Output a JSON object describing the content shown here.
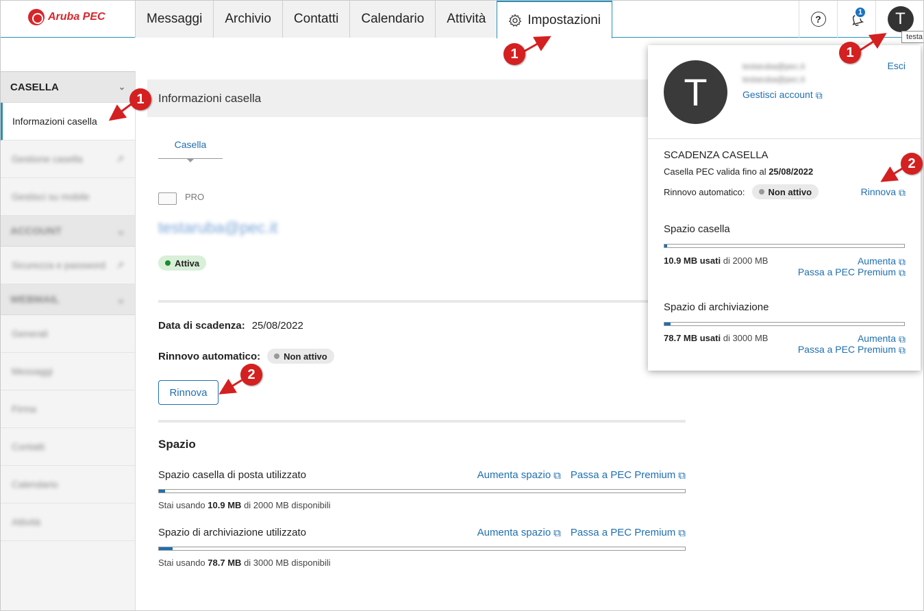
{
  "app": {
    "logo_text": "Aruba PEC"
  },
  "nav": {
    "tabs": [
      {
        "label": "Messaggi"
      },
      {
        "label": "Archivio"
      },
      {
        "label": "Contatti"
      },
      {
        "label": "Calendario"
      },
      {
        "label": "Attività"
      },
      {
        "label": "Impostazioni",
        "icon": "gear-icon",
        "active": true
      }
    ],
    "help_icon": "?",
    "notifications_count": "1",
    "avatar_letter": "T",
    "tooltip": "testa"
  },
  "sidebar": {
    "section1": "CASELLA",
    "items": [
      {
        "label": "Informazioni casella",
        "active": true
      },
      {
        "label": "Gestione casella"
      },
      {
        "label": "Gestisci su mobile"
      }
    ],
    "section2": "ACCOUNT",
    "items2": [
      {
        "label": "Sicurezza e password"
      }
    ],
    "section3": "WEBMAIL",
    "items3": [
      {
        "label": "Generali"
      },
      {
        "label": "Messaggi"
      },
      {
        "label": "Firma"
      },
      {
        "label": "Contatti"
      },
      {
        "label": "Calendario"
      },
      {
        "label": "Attività"
      }
    ]
  },
  "main": {
    "section_title": "Informazioni casella",
    "subtab": "Casella",
    "plan": "PRO",
    "address": "testaruba@pec.it",
    "status": "Attiva",
    "expiry_label": "Data di scadenza:",
    "expiry_value": "25/08/2022",
    "renew_label": "Rinnovo automatico:",
    "renew_status": "Non attivo",
    "renew_button": "Rinnova",
    "space_title": "Spazio",
    "mailbox": {
      "label": "Spazio casella di posta utilizzato",
      "link1": "Aumenta spazio",
      "link2": "Passa a PEC Premium",
      "prefix": "Stai usando",
      "used": "10.9 MB",
      "suffix": "di 2000 MB disponibili",
      "fill_fraction": 0.0055
    },
    "archive": {
      "label": "Spazio di archiviazione utilizzato",
      "link1": "Aumenta spazio",
      "link2": "Passa a PEC Premium",
      "prefix": "Stai usando",
      "used": "78.7 MB",
      "suffix": "di 3000 MB disponibili",
      "fill_fraction": 0.026
    }
  },
  "popup": {
    "avatar_letter": "T",
    "name_line1": "testaruba@pec.it",
    "name_line2": "testaruba@pec.it",
    "manage_account": "Gestisci account",
    "exit": "Esci",
    "expiry_heading": "SCADENZA CASELLA",
    "valid_until_prefix": "Casella PEC valida fino al",
    "valid_until_date": "25/08/2022",
    "auto_renew_label": "Rinnovo automatico:",
    "auto_renew_status": "Non attivo",
    "renew_link": "Rinnova",
    "space_heading": "Spazio casella",
    "space_used": "10.9 MB usati",
    "space_total": "di 2000 MB",
    "space_link1": "Aumenta",
    "space_link2": "Passa a PEC Premium",
    "space_fill": 0.0055,
    "archive_heading": "Spazio di archiviazione",
    "archive_used": "78.7 MB usati",
    "archive_total": "di 3000 MB",
    "archive_link1": "Aumenta",
    "archive_link2": "Passa a PEC Premium",
    "archive_fill": 0.026
  },
  "annotations": {
    "marker1": "1",
    "marker2": "2",
    "color": "#d42020"
  },
  "colors": {
    "accent": "#1e6fb0",
    "brand": "#d7262b",
    "active_border": "#2a8fb6"
  }
}
